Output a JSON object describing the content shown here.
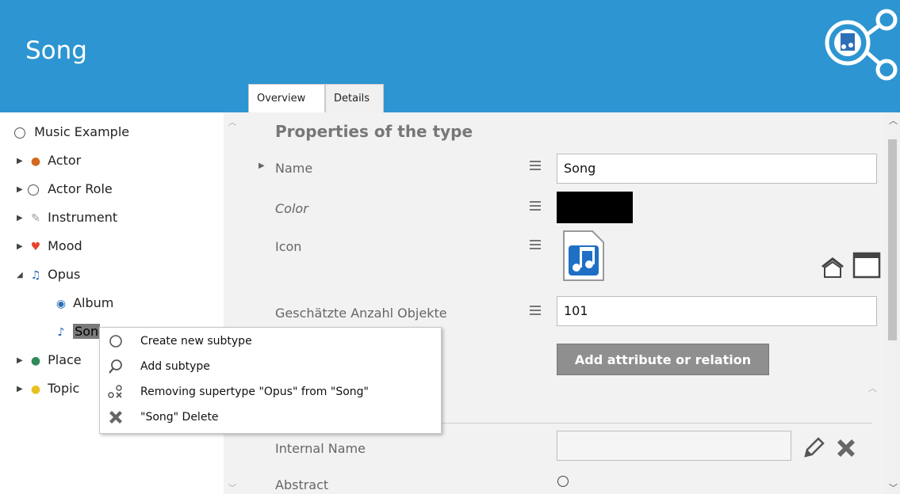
{
  "header": {
    "title": "Song"
  },
  "tabs": [
    {
      "label": "Overview"
    },
    {
      "label": "Details"
    }
  ],
  "tree": {
    "items": [
      {
        "label": "Music Example",
        "icon": "circle-icon"
      },
      {
        "label": "Actor",
        "icon": "actor-icon"
      },
      {
        "label": "Actor Role",
        "icon": "circle-icon"
      },
      {
        "label": "Instrument",
        "icon": "wrench-icon"
      },
      {
        "label": "Mood",
        "icon": "heart-icon"
      },
      {
        "label": "Opus",
        "icon": "music-note-icon"
      },
      {
        "label": "Album",
        "icon": "album-icon"
      },
      {
        "label": "Son",
        "icon": "music-file-icon"
      },
      {
        "label": "Place",
        "icon": "globe-icon"
      },
      {
        "label": "Topic",
        "icon": "lightbulb-icon"
      }
    ]
  },
  "panel": {
    "section_title": "Properties of the type",
    "name_label": "Name",
    "name_value": "Song",
    "color_label": "Color",
    "color_value": "#000000",
    "icon_label": "Icon",
    "count_label": "Geschätzte Anzahl Objekte",
    "count_value": "101",
    "add_button": "Add attribute or relation",
    "internal_name_label": "Internal Name",
    "internal_name_value": "",
    "abstract_label": "Abstract"
  },
  "context_menu": {
    "items": [
      {
        "label": "Create new subtype",
        "icon": "circle-icon"
      },
      {
        "label": "Add subtype",
        "icon": "search-icon"
      },
      {
        "label": "Removing supertype \"Opus\" from \"Song\"",
        "icon": "unlink-icon"
      },
      {
        "label": "\"Song\" Delete",
        "icon": "delete-x-icon"
      }
    ]
  },
  "colors": {
    "header": "#2d95d1",
    "panel": "#f2f2f2",
    "button": "#8f8f8f"
  }
}
